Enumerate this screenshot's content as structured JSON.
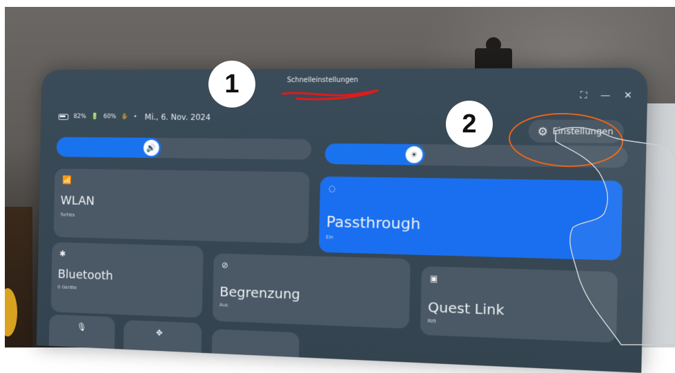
{
  "header": {
    "title": "Schnelleinstellungen"
  },
  "window_controls": {
    "expand": "⛶",
    "minimize": "—",
    "close": "✕"
  },
  "status": {
    "battery_headset": "82%",
    "battery_controller": "60%",
    "separator": "•",
    "date": "Mi., 6. Nov. 2024"
  },
  "settings_button": {
    "label": "Einstellungen"
  },
  "sliders": {
    "volume_level": 0.42,
    "brightness_level": 0.34
  },
  "tiles": {
    "wlan": {
      "label": "WLAN",
      "sub": "Turtles"
    },
    "passthrough": {
      "label": "Passthrough",
      "sub": "Ein"
    },
    "bluetooth": {
      "label": "Bluetooth",
      "sub": "0 Geräte"
    },
    "boundary": {
      "label": "Begrenzung",
      "sub": "Aus"
    },
    "quest_link": {
      "label": "Quest Link",
      "sub": "Rift"
    }
  },
  "markers": {
    "one": "1",
    "two": "2"
  },
  "colors": {
    "accent": "#1a6ff0",
    "annotation_red": "#e01b1b",
    "annotation_orange": "#e8631a"
  }
}
